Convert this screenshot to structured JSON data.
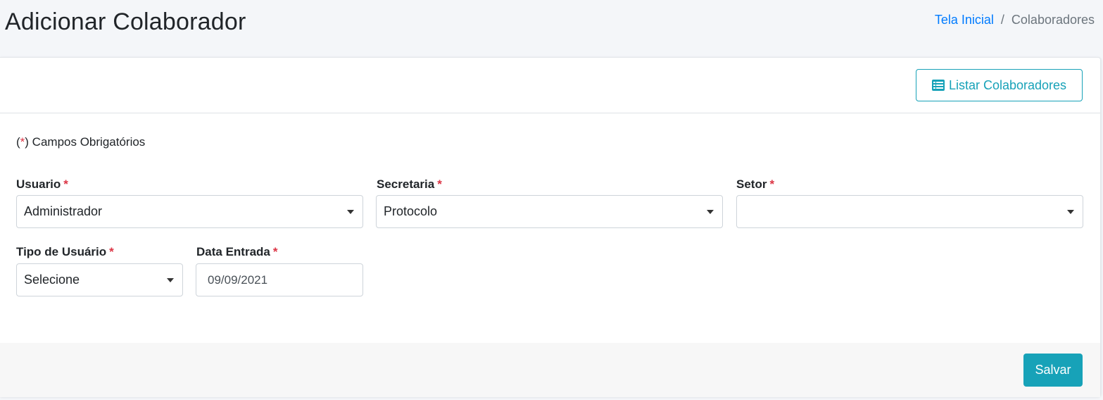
{
  "header": {
    "title": "Adicionar Colaborador",
    "breadcrumb": {
      "home": "Tela Inicial",
      "separator": "/",
      "current": "Colaboradores"
    }
  },
  "card": {
    "list_button_label": "Listar Colaboradores",
    "list_button_icon": "list-icon",
    "required_note": {
      "open": "(",
      "mark": "*",
      "close": ") Campos Obrigatórios"
    },
    "fields": {
      "usuario": {
        "label": "Usuario",
        "required_mark": "*",
        "value": "Administrador"
      },
      "secretaria": {
        "label": "Secretaria",
        "required_mark": "*",
        "value": "Protocolo"
      },
      "setor": {
        "label": "Setor",
        "required_mark": "*",
        "value": ""
      },
      "tipo_usuario": {
        "label": "Tipo de Usuário",
        "required_mark": "*",
        "value": "Selecione"
      },
      "data_entrada": {
        "label": "Data Entrada",
        "required_mark": "*",
        "value": "09/09/2021"
      }
    },
    "save_label": "Salvar"
  },
  "colors": {
    "accent": "#17a2b8",
    "link": "#007bff",
    "required": "#dc3545"
  }
}
